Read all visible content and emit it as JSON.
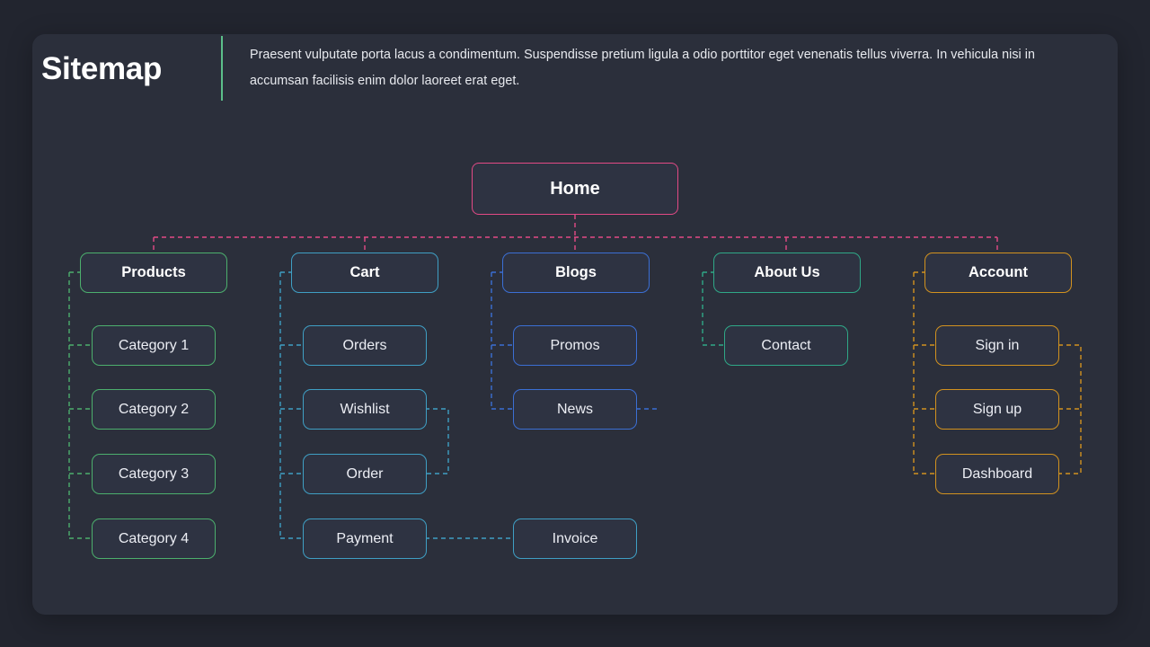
{
  "header": {
    "title": "Sitemap",
    "description": "Praesent vulputate porta lacus a condimentum. Suspendisse pretium ligula a odio porttitor eget venenatis tellus viverra. In vehicula nisi in accumsan facilisis enim dolor laoreet erat eget.",
    "divider_color": "#5bbf8a"
  },
  "colors": {
    "page_background": "#22252f",
    "card_background": "#2b2f3b",
    "node_fill": "#2e3342",
    "root": "#e34a86",
    "products": "#4caf6d",
    "cart": "#3f9fc4",
    "blogs": "#3b6fd4",
    "about": "#2fa887",
    "account": "#d2921f"
  },
  "diagram": {
    "type": "sitemap-tree",
    "root": {
      "label": "Home",
      "color": "#e34a86"
    },
    "branches": [
      {
        "label": "Products",
        "color": "#4caf6d",
        "children": [
          {
            "label": "Category 1"
          },
          {
            "label": "Category 2"
          },
          {
            "label": "Category 3"
          },
          {
            "label": "Category 4"
          }
        ]
      },
      {
        "label": "Cart",
        "color": "#3f9fc4",
        "children": [
          {
            "label": "Orders"
          },
          {
            "label": "Wishlist"
          },
          {
            "label": "Order"
          },
          {
            "label": "Payment"
          }
        ]
      },
      {
        "label": "Blogs",
        "color": "#3b6fd4",
        "children": [
          {
            "label": "Promos"
          },
          {
            "label": "News"
          },
          {
            "label": "Invoice"
          }
        ]
      },
      {
        "label": "About Us",
        "color": "#2fa887",
        "children": [
          {
            "label": "Contact"
          }
        ]
      },
      {
        "label": "Account",
        "color": "#d2921f",
        "children": [
          {
            "label": "Sign in"
          },
          {
            "label": "Sign up"
          },
          {
            "label": "Dashboard"
          }
        ]
      }
    ]
  }
}
